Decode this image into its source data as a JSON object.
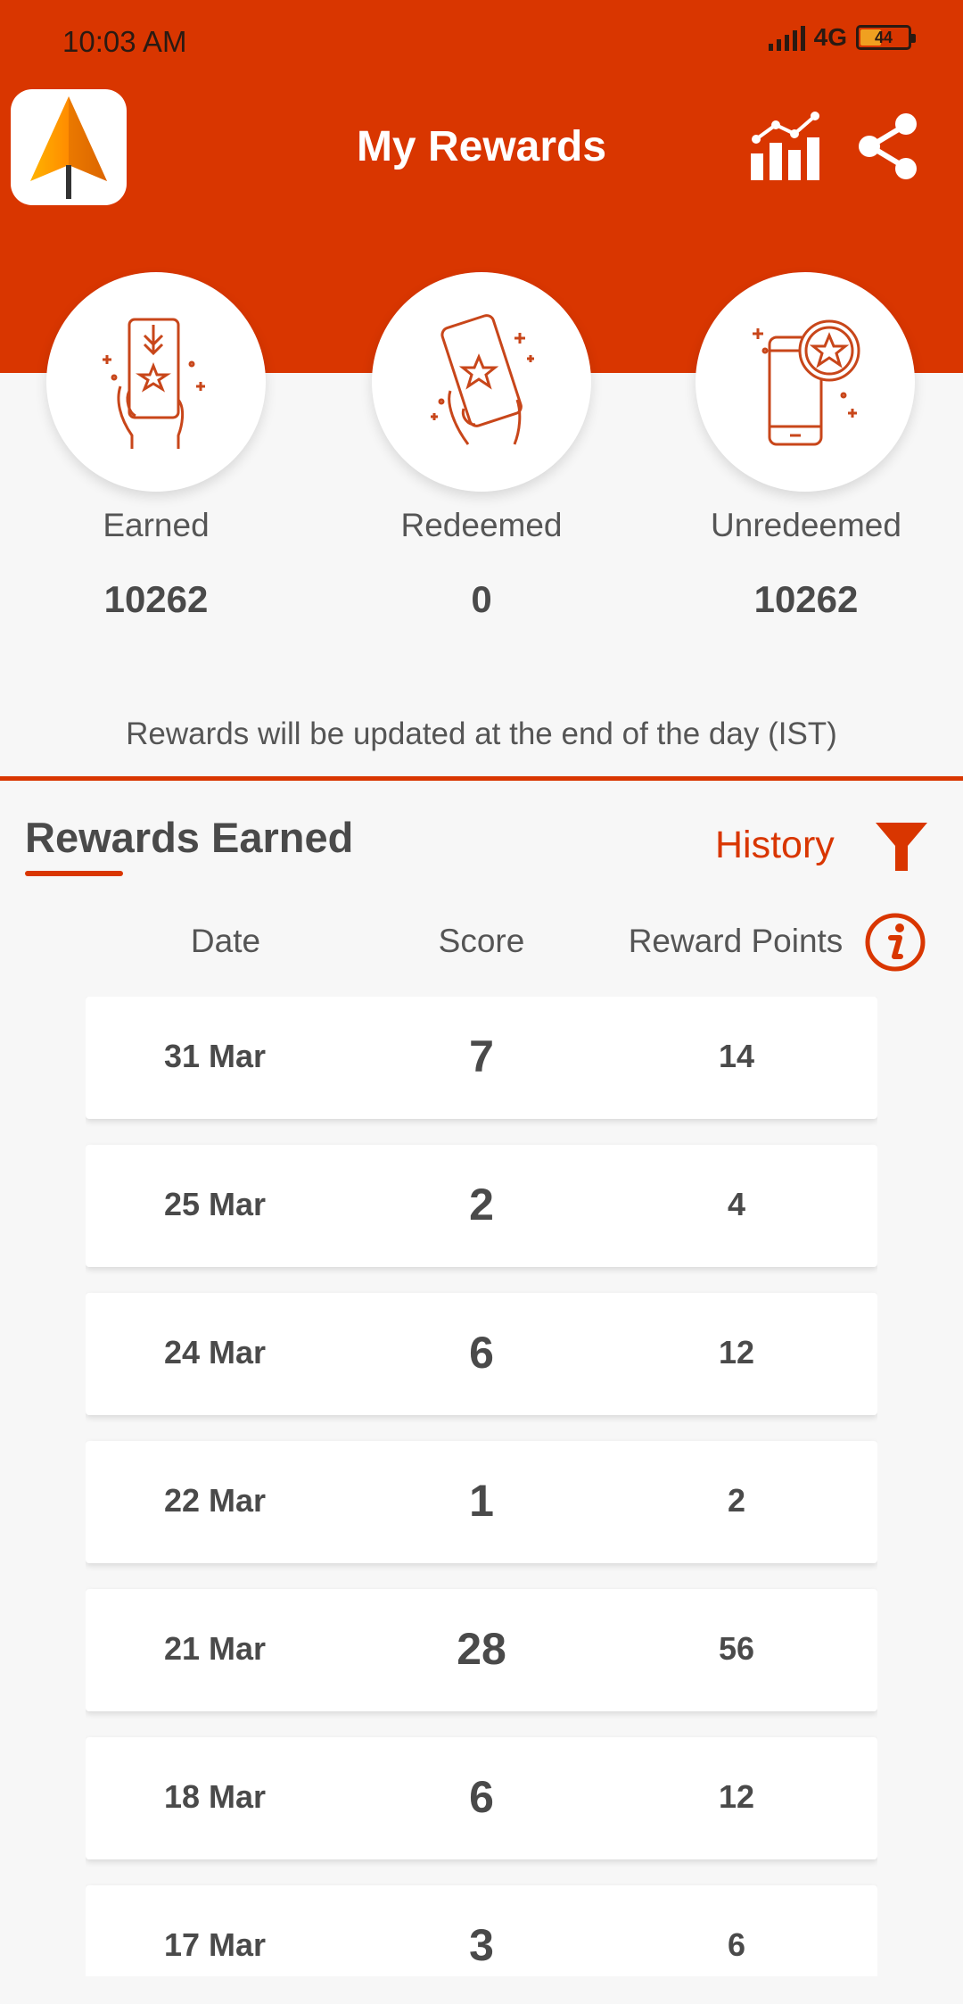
{
  "status_bar": {
    "time": "10:03 AM",
    "network": "4G",
    "battery": "44",
    "battery_level": 0.44
  },
  "app_bar": {
    "title": "My Rewards",
    "icons": [
      "app-logo",
      "stats-icon",
      "share-icon"
    ]
  },
  "stats": [
    {
      "label": "Earned",
      "value": "10262",
      "icon": "earned-icon"
    },
    {
      "label": "Redeemed",
      "value": "0",
      "icon": "redeemed-icon"
    },
    {
      "label": "Unredeemed",
      "value": "10262",
      "icon": "unredeemed-icon"
    }
  ],
  "notice": "Rewards will be updated at the end of the day (IST)",
  "section": {
    "title": "Rewards Earned",
    "history_label": "History"
  },
  "table": {
    "headers": [
      "Date",
      "Score",
      "Reward Points"
    ],
    "rows": [
      {
        "date": "31 Mar",
        "score": "7",
        "points": "14"
      },
      {
        "date": "25 Mar",
        "score": "2",
        "points": "4"
      },
      {
        "date": "24 Mar",
        "score": "6",
        "points": "12"
      },
      {
        "date": "22 Mar",
        "score": "1",
        "points": "2"
      },
      {
        "date": "21 Mar",
        "score": "28",
        "points": "56"
      },
      {
        "date": "18 Mar",
        "score": "6",
        "points": "12"
      },
      {
        "date": "17 Mar",
        "score": "3",
        "points": "6"
      }
    ]
  },
  "colors": {
    "brand": "#d93600",
    "background": "#f7f7f7",
    "text": "#4a4a4a"
  }
}
